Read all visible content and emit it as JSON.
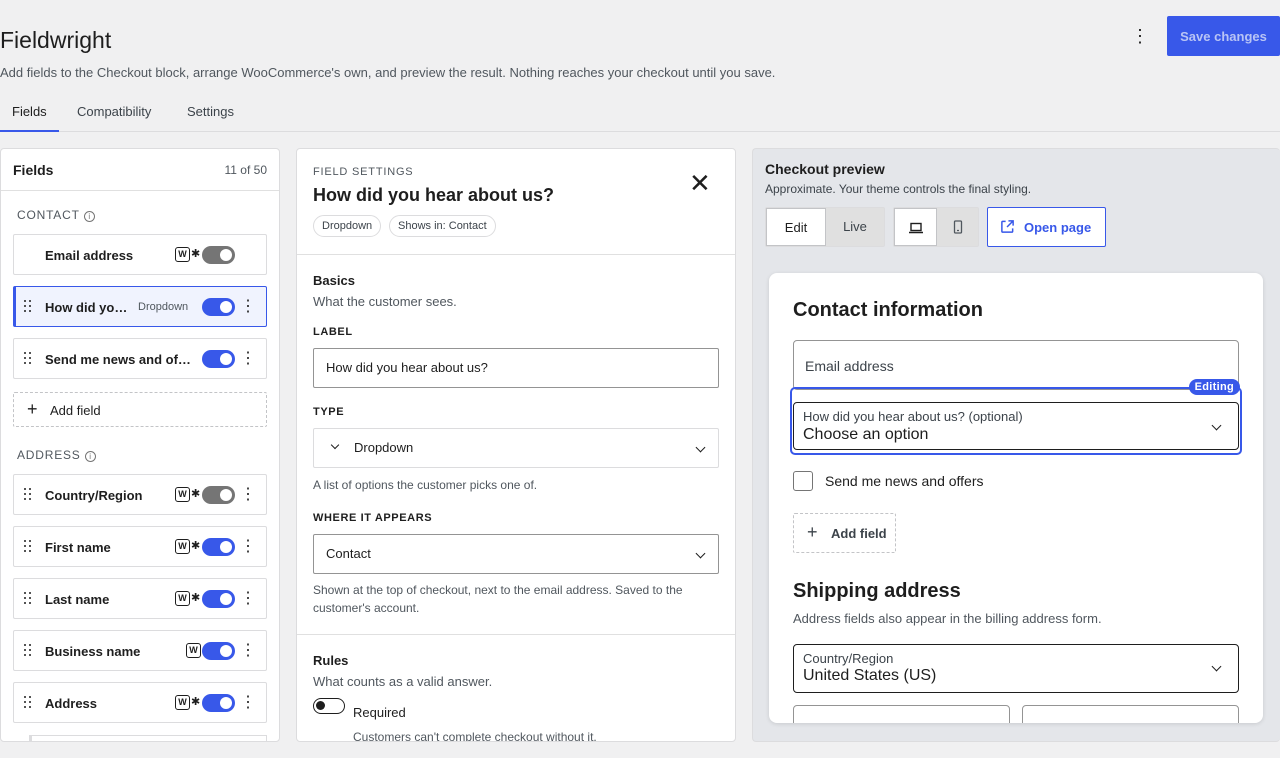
{
  "header": {
    "title": "Fieldwright",
    "subtitle": "Add fields to the Checkout block, arrange WooCommerce's own, and preview the result. Nothing reaches your checkout until you save.",
    "save_label": "Save changes",
    "more_icon": "vertical-ellipsis-icon"
  },
  "tabs": [
    {
      "label": "Fields",
      "active": true
    },
    {
      "label": "Compatibility",
      "active": false
    },
    {
      "label": "Settings",
      "active": false
    }
  ],
  "fields_panel": {
    "title": "Fields",
    "count": "11 of 50",
    "groups": [
      {
        "label": "CONTACT"
      },
      {
        "label": "ADDRESS"
      }
    ],
    "contact_rows": [
      {
        "label": "Email address",
        "type": "",
        "woo_badge": "W",
        "required_mark": "✱",
        "enabled": false,
        "draggable": false
      },
      {
        "label": "How did you hear about us?",
        "type": "Dropdown",
        "woo_badge": "",
        "required_mark": "",
        "enabled": true,
        "draggable": true,
        "selected": true
      },
      {
        "label": "Send me news and offers",
        "type": "",
        "woo_badge": "",
        "required_mark": "",
        "enabled": true,
        "draggable": true
      }
    ],
    "add_field_label": "Add field",
    "address_rows": [
      {
        "label": "Country/Region",
        "woo_badge": "W",
        "required_mark": "✱",
        "enabled": false
      },
      {
        "label": "First name",
        "woo_badge": "W",
        "required_mark": "✱",
        "enabled": true
      },
      {
        "label": "Last name",
        "woo_badge": "W",
        "required_mark": "✱",
        "enabled": true
      },
      {
        "label": "Business name",
        "woo_badge": "W",
        "required_mark": "",
        "enabled": true
      },
      {
        "label": "Address",
        "woo_badge": "W",
        "required_mark": "✱",
        "enabled": true
      }
    ]
  },
  "settings_panel": {
    "kicker": "FIELD SETTINGS",
    "title": "How did you hear about us?",
    "chips": [
      "Dropdown",
      "Shows in: Contact"
    ],
    "basics": {
      "title": "Basics",
      "subtitle": "What the customer sees.",
      "label_heading": "LABEL",
      "label_value": "How did you hear about us?",
      "type_heading": "TYPE",
      "type_value": "Dropdown",
      "type_help": "A list of options the customer picks one of.",
      "where_heading": "WHERE IT APPEARS",
      "where_value": "Contact",
      "where_help": "Shown at the top of checkout, next to the email address. Saved to the customer's account."
    },
    "rules": {
      "title": "Rules",
      "subtitle": "What counts as a valid answer.",
      "required_label": "Required",
      "required_on": false,
      "required_help": "Customers can't complete checkout without it."
    }
  },
  "preview_panel": {
    "title": "Checkout preview",
    "subtitle": "Approximate. Your theme controls the final styling.",
    "mode_options": [
      {
        "label": "Edit",
        "active": true
      },
      {
        "label": "Live",
        "active": false
      }
    ],
    "device_options": [
      {
        "icon": "laptop-icon",
        "active": true
      },
      {
        "icon": "phone-icon",
        "active": false
      }
    ],
    "open_page_label": "Open page",
    "contact_heading": "Contact information",
    "email_placeholder": "Email address",
    "editing_badge": "Editing",
    "dropdown_label": "How did you hear about us? (optional)",
    "dropdown_value": "Choose an option",
    "newsletter_label": "Send me news and offers",
    "add_field_label": "Add field",
    "shipping_heading": "Shipping address",
    "shipping_sub": "Address fields also appear in the billing address form.",
    "country_label": "Country/Region",
    "country_value": "United States (US)"
  },
  "colors": {
    "accent": "#3858e9",
    "background": "#f0f0f1",
    "border": "#dcdcde"
  }
}
